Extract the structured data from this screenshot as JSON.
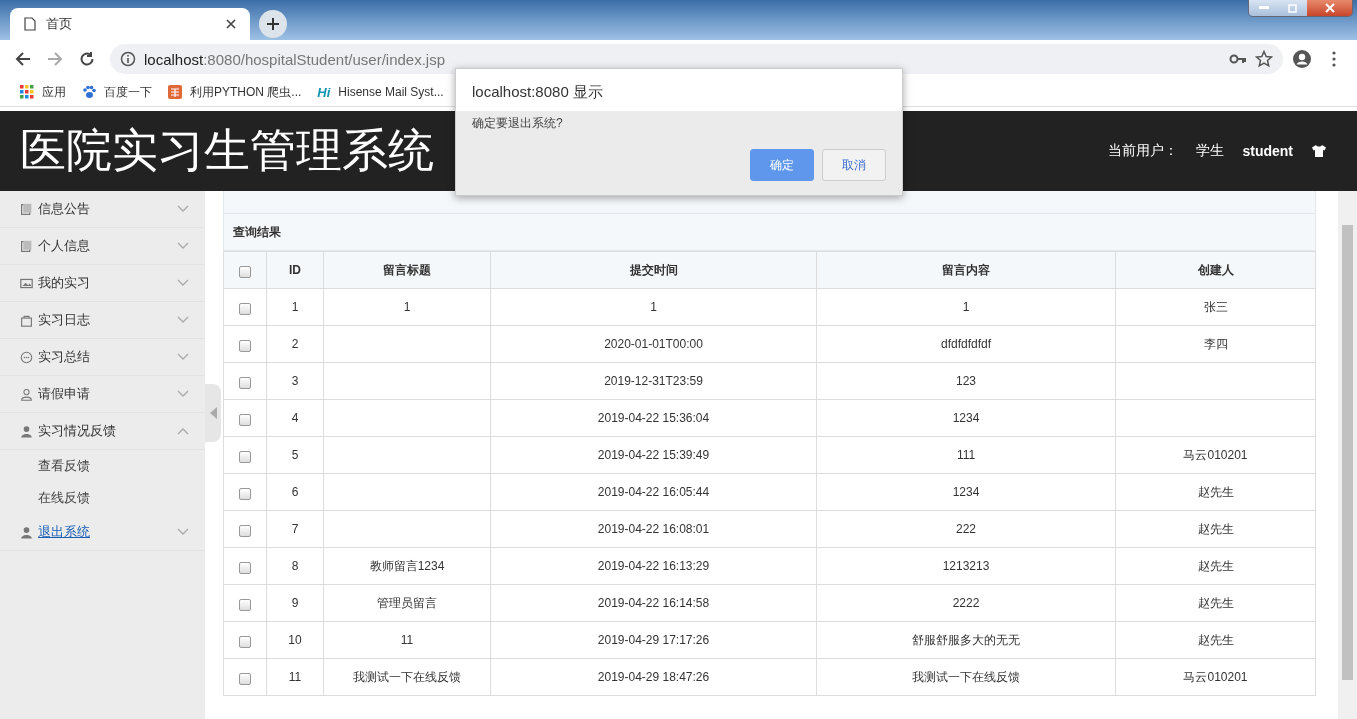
{
  "browser": {
    "tab_title": "首页",
    "url_host": "localhost",
    "url_rest": ":8080/hospitalStudent/user/index.jsp",
    "bookmarks": [
      {
        "label": "应用",
        "kind": "apps"
      },
      {
        "label": "百度一下",
        "kind": "paw"
      },
      {
        "label": "利用PYTHON 爬虫...",
        "kind": "jian"
      },
      {
        "label": "Hisense Mail Syst...",
        "kind": "hi",
        "icon_text": "Hi"
      }
    ]
  },
  "header": {
    "title": "医院实习生管理系统",
    "user_label": "当前用户：",
    "role": "学生",
    "username": "student"
  },
  "sidebar": {
    "items": [
      {
        "label": "信息公告",
        "kind": "doc",
        "expanded": false,
        "link": false
      },
      {
        "label": "个人信息",
        "kind": "doc",
        "expanded": false,
        "link": false
      },
      {
        "label": "我的实习",
        "kind": "image",
        "expanded": false,
        "link": false
      },
      {
        "label": "实习日志",
        "kind": "bag",
        "expanded": false,
        "link": false
      },
      {
        "label": "实习总结",
        "kind": "chat",
        "expanded": false,
        "link": false
      },
      {
        "label": "请假申请",
        "kind": "person",
        "expanded": false,
        "link": false
      },
      {
        "label": "实习情况反馈",
        "kind": "person-solid",
        "expanded": true,
        "link": false,
        "children": [
          {
            "label": "查看反馈"
          },
          {
            "label": "在线反馈"
          }
        ]
      },
      {
        "label": "退出系统",
        "kind": "person-solid",
        "expanded": false,
        "link": true
      }
    ]
  },
  "panel": {
    "title": "查询结果"
  },
  "table": {
    "header_checked": false,
    "columns": [
      "ID",
      "留言标题",
      "提交时间",
      "留言内容",
      "创建人"
    ],
    "rows": [
      {
        "checked": false,
        "cells": [
          "1",
          "1",
          "1",
          "1",
          "张三"
        ]
      },
      {
        "checked": false,
        "cells": [
          "2",
          "",
          "2020-01-01T00:00",
          "dfdfdfdfdf",
          "李四"
        ]
      },
      {
        "checked": false,
        "cells": [
          "3",
          "",
          "2019-12-31T23:59",
          "123",
          ""
        ]
      },
      {
        "checked": false,
        "cells": [
          "4",
          "",
          "2019-04-22 15:36:04",
          "1234",
          ""
        ]
      },
      {
        "checked": false,
        "cells": [
          "5",
          "",
          "2019-04-22 15:39:49",
          "111",
          "马云010201"
        ]
      },
      {
        "checked": false,
        "cells": [
          "6",
          "",
          "2019-04-22 16:05:44",
          "1234",
          "赵先生"
        ]
      },
      {
        "checked": false,
        "cells": [
          "7",
          "",
          "2019-04-22 16:08:01",
          "222",
          "赵先生"
        ]
      },
      {
        "checked": false,
        "cells": [
          "8",
          "教师留言1234",
          "2019-04-22 16:13:29",
          "1213213",
          "赵先生"
        ]
      },
      {
        "checked": false,
        "cells": [
          "9",
          "管理员留言",
          "2019-04-22 16:14:58",
          "2222",
          "赵先生"
        ]
      },
      {
        "checked": false,
        "cells": [
          "10",
          "11",
          "2019-04-29 17:17:26",
          "舒服舒服多大的无无",
          "赵先生"
        ]
      },
      {
        "checked": false,
        "cells": [
          "11",
          "我测试一下在线反馈",
          "2019-04-29 18:47:26",
          "我测试一下在线反馈",
          "马云010201"
        ]
      }
    ]
  },
  "dialog": {
    "title": "localhost:8080 显示",
    "message": "确定要退出系统?",
    "buttons": [
      {
        "label": "确定",
        "primary": true
      },
      {
        "label": "取消",
        "primary": false
      }
    ]
  }
}
